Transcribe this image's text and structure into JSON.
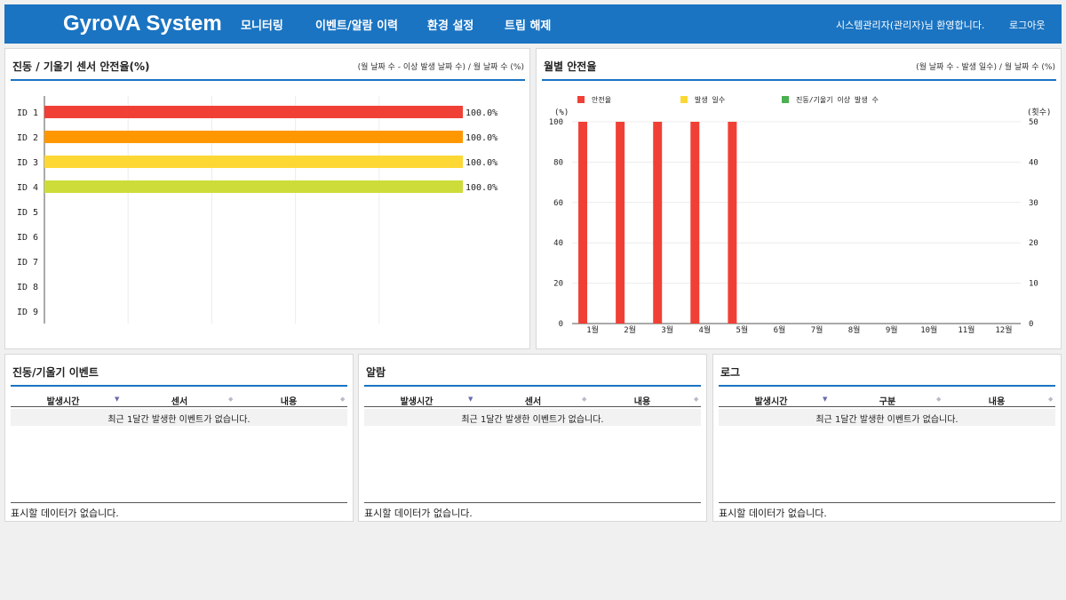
{
  "header": {
    "brand": "GyroVA System",
    "nav": [
      "모니터링",
      "이벤트/알람 이력",
      "환경 설정",
      "트립 해제"
    ],
    "welcome": "시스템관리자(관리자)님 환영합니다.",
    "logout": "로그아웃"
  },
  "sensor_panel": {
    "title": "진동 / 기울기 센서 안전율(%)",
    "note": "(월 날짜 수 - 이상 발생 날짜 수) / 월 날짜 수 (%)",
    "chart_data": {
      "type": "bar",
      "orientation": "horizontal",
      "categories": [
        "ID 1",
        "ID 2",
        "ID 3",
        "ID 4",
        "ID 5",
        "ID 6",
        "ID 7",
        "ID 8",
        "ID 9"
      ],
      "values": [
        100,
        100,
        100,
        100,
        null,
        null,
        null,
        null,
        null
      ],
      "value_labels": [
        "100.0%",
        "100.0%",
        "100.0%",
        "100.0%",
        "",
        "",
        "",
        "",
        ""
      ],
      "bar_colors": [
        "#f04036",
        "#ff9800",
        "#fdd835",
        "#cddc39",
        "#cddc39",
        "#cddc39",
        "#cddc39",
        "#cddc39",
        "#cddc39"
      ],
      "xlim": [
        0,
        100
      ],
      "grid": true
    }
  },
  "monthly_panel": {
    "title": "월별 안전율",
    "note": "(월 날짜 수 - 발생 일수) / 월 날짜 수 (%)",
    "chart_data": {
      "type": "bar",
      "categories": [
        "1월",
        "2월",
        "3월",
        "4월",
        "5월",
        "6월",
        "7월",
        "8월",
        "9월",
        "10월",
        "11월",
        "12월"
      ],
      "series": [
        {
          "name": "안전율",
          "color": "#f04036",
          "axis": "left",
          "values": [
            100,
            100,
            100,
            100,
            100,
            null,
            null,
            null,
            null,
            null,
            null,
            null
          ]
        },
        {
          "name": "발생 일수",
          "color": "#fdd835",
          "axis": "right",
          "values": [
            0,
            0,
            0,
            0,
            0,
            null,
            null,
            null,
            null,
            null,
            null,
            null
          ]
        },
        {
          "name": "진동/기울기 이상 발생 수",
          "color": "#4caf50",
          "axis": "right",
          "values": [
            0,
            0,
            0,
            0,
            0,
            null,
            null,
            null,
            null,
            null,
            null,
            null
          ]
        }
      ],
      "ylabel_left": "(%)",
      "ylabel_right": "(횟수)",
      "ylim_left": [
        0,
        100
      ],
      "ylim_right": [
        0,
        50
      ],
      "yticks_left": [
        "0",
        "20",
        "40",
        "60",
        "80",
        "100"
      ],
      "yticks_right": [
        "0",
        "10",
        "20",
        "30",
        "40",
        "50"
      ],
      "legend_position": "top-left",
      "grid": true
    }
  },
  "tables": [
    {
      "title": "진동/기울기 이벤트",
      "columns": [
        "발생시간",
        "센서",
        "내용"
      ],
      "empty_message": "최근 1달간 발생한 이벤트가 없습니다.",
      "footer": "표시할 데이터가 없습니다."
    },
    {
      "title": "알람",
      "columns": [
        "발생시간",
        "센서",
        "내용"
      ],
      "empty_message": "최근 1달간 발생한 이벤트가 없습니다.",
      "footer": "표시할 데이터가 없습니다."
    },
    {
      "title": "로그",
      "columns": [
        "발생시간",
        "구분",
        "내용"
      ],
      "empty_message": "최근 1달간 발생한 이벤트가 없습니다.",
      "footer": "표시할 데이터가 없습니다."
    }
  ],
  "colors": {
    "accent": "#1a74c2"
  }
}
